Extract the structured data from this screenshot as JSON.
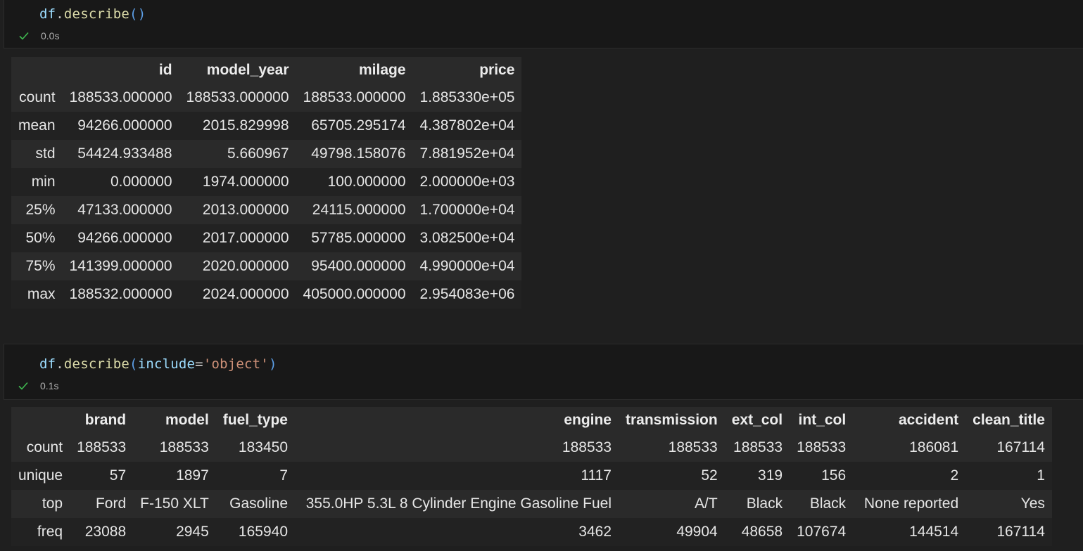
{
  "cells": [
    {
      "code": {
        "var": "df",
        "dot": ".",
        "fn": "describe",
        "open": "(",
        "close": ")"
      },
      "status": {
        "icon": "checkmark-icon",
        "time": "0.0s"
      },
      "output": {
        "columns": [
          "",
          "id",
          "model_year",
          "milage",
          "price"
        ],
        "rows": [
          [
            "count",
            "188533.000000",
            "188533.000000",
            "188533.000000",
            "1.885330e+05"
          ],
          [
            "mean",
            "94266.000000",
            "2015.829998",
            "65705.295174",
            "4.387802e+04"
          ],
          [
            "std",
            "54424.933488",
            "5.660967",
            "49798.158076",
            "7.881952e+04"
          ],
          [
            "min",
            "0.000000",
            "1974.000000",
            "100.000000",
            "2.000000e+03"
          ],
          [
            "25%",
            "47133.000000",
            "2013.000000",
            "24115.000000",
            "1.700000e+04"
          ],
          [
            "50%",
            "94266.000000",
            "2017.000000",
            "57785.000000",
            "3.082500e+04"
          ],
          [
            "75%",
            "141399.000000",
            "2020.000000",
            "95400.000000",
            "4.990000e+04"
          ],
          [
            "max",
            "188532.000000",
            "2024.000000",
            "405000.000000",
            "2.954083e+06"
          ]
        ]
      }
    },
    {
      "code": {
        "var": "df",
        "dot": ".",
        "fn": "describe",
        "open": "(",
        "param": "include",
        "eq": "=",
        "str": "'object'",
        "close": ")"
      },
      "status": {
        "icon": "checkmark-icon",
        "time": "0.1s"
      },
      "output": {
        "columns": [
          "",
          "brand",
          "model",
          "fuel_type",
          "engine",
          "transmission",
          "ext_col",
          "int_col",
          "accident",
          "clean_title"
        ],
        "rows": [
          [
            "count",
            "188533",
            "188533",
            "183450",
            "188533",
            "188533",
            "188533",
            "188533",
            "186081",
            "167114"
          ],
          [
            "unique",
            "57",
            "1897",
            "7",
            "1117",
            "52",
            "319",
            "156",
            "2",
            "1"
          ],
          [
            "top",
            "Ford",
            "F-150 XLT",
            "Gasoline",
            "355.0HP 5.3L 8 Cylinder Engine Gasoline Fuel",
            "A/T",
            "Black",
            "Black",
            "None reported",
            "Yes"
          ],
          [
            "freq",
            "23088",
            "2945",
            "165940",
            "3462",
            "49904",
            "48658",
            "107674",
            "144514",
            "167114"
          ]
        ]
      }
    }
  ],
  "colors": {
    "background": "#1f1f1f",
    "cell_background": "#181818",
    "row_odd": "#2a2a2a",
    "row_even": "#222222",
    "success_check": "#3fb950",
    "code_variable": "#9cdcfe",
    "code_function": "#dcdcaa",
    "code_string": "#ce9178"
  }
}
